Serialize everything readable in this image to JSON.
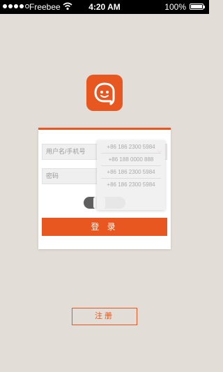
{
  "status_bar": {
    "carrier": "Freebee",
    "time": "4:20 AM",
    "battery": "100%"
  },
  "icons": {
    "app_logo": "chat-bubble-logo-icon",
    "dropdown": "chevron-down-icon",
    "wifi": "wifi-icon"
  },
  "login": {
    "username_placeholder": "用户名/手机号",
    "password_placeholder": "密码",
    "login_label": "登 录",
    "accounts": [
      "+86 186 2300 5984",
      "+86 188 0000 888",
      "+86 186 2300 5984",
      "+86 186 2300 5984"
    ]
  },
  "register": {
    "label": "注册"
  },
  "colors": {
    "accent": "#e8571f",
    "background": "#e2ddd6"
  }
}
